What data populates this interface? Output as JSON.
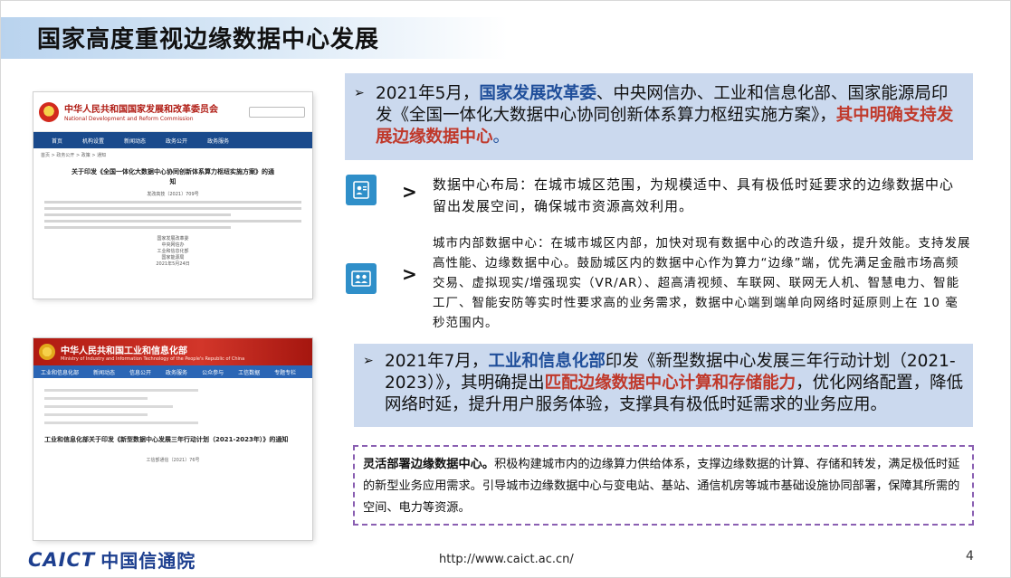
{
  "page": {
    "title": "国家高度重视边缘数据中心发展",
    "page_number": "4"
  },
  "screenshot_ndrc": {
    "org_cn": "中华人民共和国国家发展和改革委员会",
    "org_en": "National Development and Reform Commission",
    "nav": [
      "首页",
      "机构设置",
      "新闻动态",
      "政务公开",
      "政务服务"
    ],
    "breadcrumb": "首页 > 政务公开 > 政策 > 通知",
    "doc_title": "关于印发《全国一体化大数据中心协同创新体系算力枢纽实施方案》的通知",
    "doc_no": "发改高技〔2021〕709号",
    "signers": [
      "国家发展改革委",
      "中央网信办",
      "工业和信息化部",
      "国家能源局",
      "2021年5月24日"
    ]
  },
  "screenshot_miit": {
    "org_cn": "中华人民共和国工业和信息化部",
    "org_en": "Ministry of Industry and Information Technology of the People's Republic of China",
    "nav": [
      "工业和信息化部",
      "新闻动态",
      "信息公开",
      "政务服务",
      "公众参与",
      "工信数据",
      "专题专栏"
    ],
    "doc_title": "工业和信息化部关于印发《新型数据中心发展三年行动计划（2021-2023年）》的通知",
    "doc_no": "工信部通信〔2021〕76号"
  },
  "box1": {
    "arrow": "➢",
    "p1": "2021年5月，",
    "p2": "国家发展改革委",
    "p3": "、中央网信办、工业和信息化部、国家能源局印发《全国一体化大数据中心协同创新体系算力枢纽实施方案》，",
    "p4": "其中明确支持发展边缘数据中心",
    "p5": "。"
  },
  "item1": {
    "icon": "id-card-icon",
    "chevron": ">",
    "text": "数据中心布局：在城市城区范围，为规模适中、具有极低时延要求的边缘数据中心留出发展空间，确保城市资源高效利用。"
  },
  "item2": {
    "icon": "people-icon",
    "chevron": ">",
    "text": "城市内部数据中心：在城市城区内部，加快对现有数据中心的改造升级，提升效能。支持发展高性能、边缘数据中心。鼓励城区内的数据中心作为算力“边缘”端，优先满足金融市场高频交易、虚拟现实/增强现实（VR/AR）、超高清视频、车联网、联网无人机、智慧电力、智能工厂、智能安防等实时性要求高的业务需求，数据中心端到端单向网络时延原则上在 10 毫秒范围内。"
  },
  "box2": {
    "arrow": "➢",
    "p1": "2021年7月，",
    "p2": "工业和信息化部",
    "p3": "印发《新型数据中心发展三年行动计划（2021-2023）》，其明确提出",
    "p4": "匹配边缘数据中心计算和存储能力",
    "p5": "，优化网络配置，降低网络时延，提升用户服务体验，支撑具有极低时延需求的业务应用。"
  },
  "dash": {
    "lead": "灵活部署边缘数据中心。",
    "text": "积极构建城市内的边缘算力供给体系，支撑边缘数据的计算、存储和转发，满足极低时延的新型业务应用需求。引导城市边缘数据中心与变电站、基站、通信机房等城市基础设施协同部署，保障其所需的空间、电力等资源。"
  },
  "footer": {
    "logo_en": "CAICT",
    "logo_cn": "中国信通院",
    "url": "http://www.caict.ac.cn/"
  },
  "colors": {
    "accent_blue": "#1f4e9a",
    "accent_red": "#c0392b",
    "box_bg": "#cbd9ee",
    "dash_border": "#8a5fb2"
  }
}
